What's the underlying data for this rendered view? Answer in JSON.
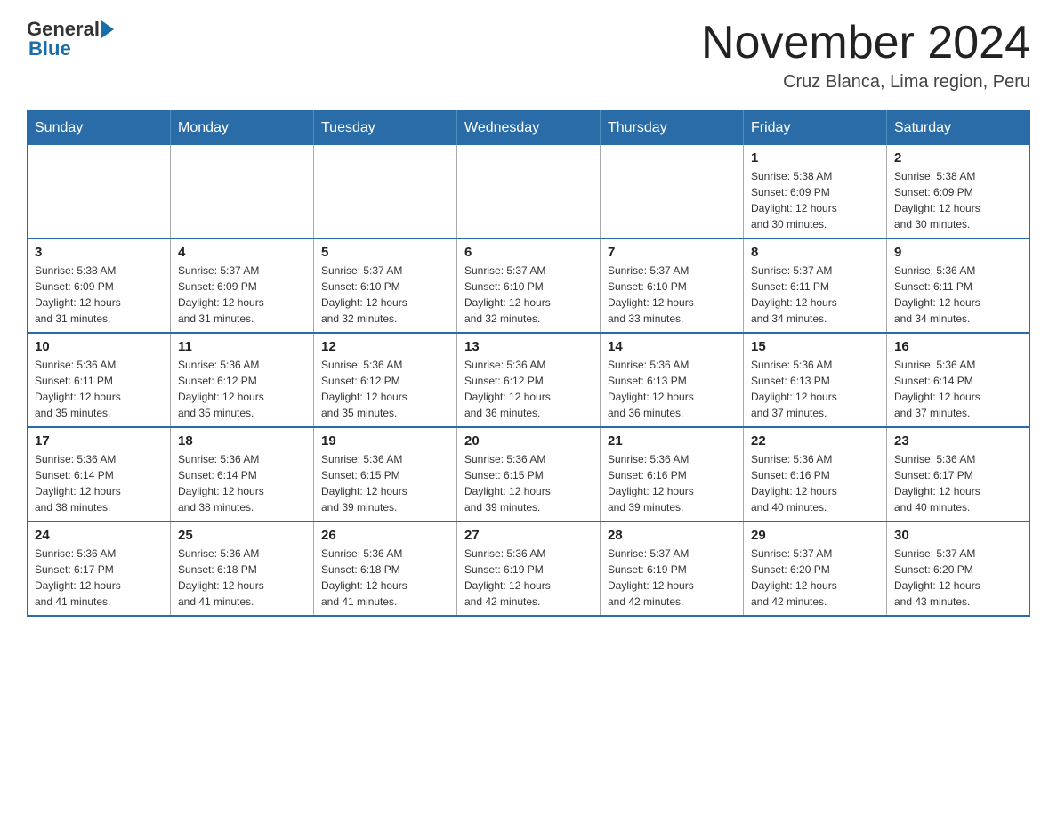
{
  "logo": {
    "general": "General",
    "blue": "Blue"
  },
  "header": {
    "title": "November 2024",
    "subtitle": "Cruz Blanca, Lima region, Peru"
  },
  "weekdays": [
    "Sunday",
    "Monday",
    "Tuesday",
    "Wednesday",
    "Thursday",
    "Friday",
    "Saturday"
  ],
  "weeks": [
    [
      {
        "day": "",
        "info": ""
      },
      {
        "day": "",
        "info": ""
      },
      {
        "day": "",
        "info": ""
      },
      {
        "day": "",
        "info": ""
      },
      {
        "day": "",
        "info": ""
      },
      {
        "day": "1",
        "info": "Sunrise: 5:38 AM\nSunset: 6:09 PM\nDaylight: 12 hours\nand 30 minutes."
      },
      {
        "day": "2",
        "info": "Sunrise: 5:38 AM\nSunset: 6:09 PM\nDaylight: 12 hours\nand 30 minutes."
      }
    ],
    [
      {
        "day": "3",
        "info": "Sunrise: 5:38 AM\nSunset: 6:09 PM\nDaylight: 12 hours\nand 31 minutes."
      },
      {
        "day": "4",
        "info": "Sunrise: 5:37 AM\nSunset: 6:09 PM\nDaylight: 12 hours\nand 31 minutes."
      },
      {
        "day": "5",
        "info": "Sunrise: 5:37 AM\nSunset: 6:10 PM\nDaylight: 12 hours\nand 32 minutes."
      },
      {
        "day": "6",
        "info": "Sunrise: 5:37 AM\nSunset: 6:10 PM\nDaylight: 12 hours\nand 32 minutes."
      },
      {
        "day": "7",
        "info": "Sunrise: 5:37 AM\nSunset: 6:10 PM\nDaylight: 12 hours\nand 33 minutes."
      },
      {
        "day": "8",
        "info": "Sunrise: 5:37 AM\nSunset: 6:11 PM\nDaylight: 12 hours\nand 34 minutes."
      },
      {
        "day": "9",
        "info": "Sunrise: 5:36 AM\nSunset: 6:11 PM\nDaylight: 12 hours\nand 34 minutes."
      }
    ],
    [
      {
        "day": "10",
        "info": "Sunrise: 5:36 AM\nSunset: 6:11 PM\nDaylight: 12 hours\nand 35 minutes."
      },
      {
        "day": "11",
        "info": "Sunrise: 5:36 AM\nSunset: 6:12 PM\nDaylight: 12 hours\nand 35 minutes."
      },
      {
        "day": "12",
        "info": "Sunrise: 5:36 AM\nSunset: 6:12 PM\nDaylight: 12 hours\nand 35 minutes."
      },
      {
        "day": "13",
        "info": "Sunrise: 5:36 AM\nSunset: 6:12 PM\nDaylight: 12 hours\nand 36 minutes."
      },
      {
        "day": "14",
        "info": "Sunrise: 5:36 AM\nSunset: 6:13 PM\nDaylight: 12 hours\nand 36 minutes."
      },
      {
        "day": "15",
        "info": "Sunrise: 5:36 AM\nSunset: 6:13 PM\nDaylight: 12 hours\nand 37 minutes."
      },
      {
        "day": "16",
        "info": "Sunrise: 5:36 AM\nSunset: 6:14 PM\nDaylight: 12 hours\nand 37 minutes."
      }
    ],
    [
      {
        "day": "17",
        "info": "Sunrise: 5:36 AM\nSunset: 6:14 PM\nDaylight: 12 hours\nand 38 minutes."
      },
      {
        "day": "18",
        "info": "Sunrise: 5:36 AM\nSunset: 6:14 PM\nDaylight: 12 hours\nand 38 minutes."
      },
      {
        "day": "19",
        "info": "Sunrise: 5:36 AM\nSunset: 6:15 PM\nDaylight: 12 hours\nand 39 minutes."
      },
      {
        "day": "20",
        "info": "Sunrise: 5:36 AM\nSunset: 6:15 PM\nDaylight: 12 hours\nand 39 minutes."
      },
      {
        "day": "21",
        "info": "Sunrise: 5:36 AM\nSunset: 6:16 PM\nDaylight: 12 hours\nand 39 minutes."
      },
      {
        "day": "22",
        "info": "Sunrise: 5:36 AM\nSunset: 6:16 PM\nDaylight: 12 hours\nand 40 minutes."
      },
      {
        "day": "23",
        "info": "Sunrise: 5:36 AM\nSunset: 6:17 PM\nDaylight: 12 hours\nand 40 minutes."
      }
    ],
    [
      {
        "day": "24",
        "info": "Sunrise: 5:36 AM\nSunset: 6:17 PM\nDaylight: 12 hours\nand 41 minutes."
      },
      {
        "day": "25",
        "info": "Sunrise: 5:36 AM\nSunset: 6:18 PM\nDaylight: 12 hours\nand 41 minutes."
      },
      {
        "day": "26",
        "info": "Sunrise: 5:36 AM\nSunset: 6:18 PM\nDaylight: 12 hours\nand 41 minutes."
      },
      {
        "day": "27",
        "info": "Sunrise: 5:36 AM\nSunset: 6:19 PM\nDaylight: 12 hours\nand 42 minutes."
      },
      {
        "day": "28",
        "info": "Sunrise: 5:37 AM\nSunset: 6:19 PM\nDaylight: 12 hours\nand 42 minutes."
      },
      {
        "day": "29",
        "info": "Sunrise: 5:37 AM\nSunset: 6:20 PM\nDaylight: 12 hours\nand 42 minutes."
      },
      {
        "day": "30",
        "info": "Sunrise: 5:37 AM\nSunset: 6:20 PM\nDaylight: 12 hours\nand 43 minutes."
      }
    ]
  ]
}
